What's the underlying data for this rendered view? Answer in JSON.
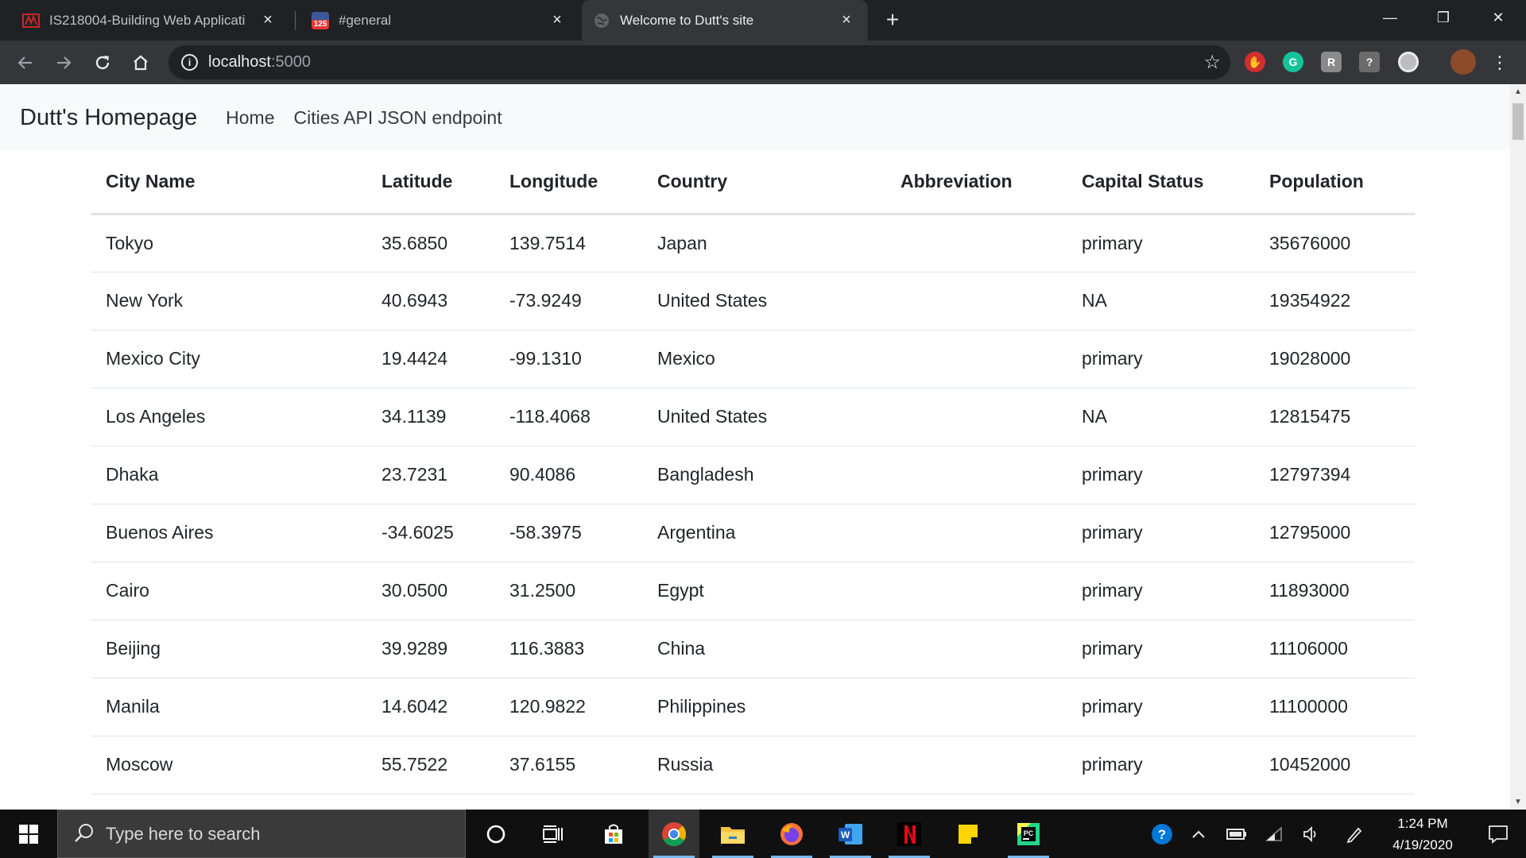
{
  "browser": {
    "tabs": [
      {
        "title": "IS218004-Building Web Applicati",
        "close": "×"
      },
      {
        "title": "#general",
        "close": "×",
        "badge": "125"
      },
      {
        "title": "Welcome to Dutt's site",
        "close": "×"
      }
    ],
    "new_tab": "+",
    "window_controls": {
      "minimize": "—",
      "restore": "❐",
      "close": "✕"
    },
    "address": {
      "host": "localhost",
      "port": ":5000"
    }
  },
  "page": {
    "brand": "Dutt's Homepage",
    "nav": [
      {
        "label": "Home"
      },
      {
        "label": "Cities API JSON endpoint"
      }
    ],
    "table": {
      "columns": [
        "City Name",
        "Latitude",
        "Longitude",
        "Country",
        "Abbreviation",
        "Capital Status",
        "Population"
      ],
      "rows": [
        [
          "Tokyo",
          "35.6850",
          "139.7514",
          "Japan",
          "",
          "primary",
          "35676000"
        ],
        [
          "New York",
          "40.6943",
          "-73.9249",
          "United States",
          "",
          "NA",
          "19354922"
        ],
        [
          "Mexico City",
          "19.4424",
          "-99.1310",
          "Mexico",
          "",
          "primary",
          "19028000"
        ],
        [
          "Los Angeles",
          "34.1139",
          "-118.4068",
          "United States",
          "",
          "NA",
          "12815475"
        ],
        [
          "Dhaka",
          "23.7231",
          "90.4086",
          "Bangladesh",
          "",
          "primary",
          "12797394"
        ],
        [
          "Buenos Aires",
          "-34.6025",
          "-58.3975",
          "Argentina",
          "",
          "primary",
          "12795000"
        ],
        [
          "Cairo",
          "30.0500",
          "31.2500",
          "Egypt",
          "",
          "primary",
          "11893000"
        ],
        [
          "Beijing",
          "39.9289",
          "116.3883",
          "China",
          "",
          "primary",
          "11106000"
        ],
        [
          "Manila",
          "14.6042",
          "120.9822",
          "Philippines",
          "",
          "primary",
          "11100000"
        ],
        [
          "Moscow",
          "55.7522",
          "37.6155",
          "Russia",
          "",
          "primary",
          "10452000"
        ]
      ]
    }
  },
  "taskbar": {
    "search_placeholder": "Type here to search",
    "time": "1:24 PM",
    "date": "4/19/2020"
  },
  "colors": {
    "tabbar_bg": "#202124",
    "toolbar_bg": "#35363a",
    "navbar_bg": "#f8f9fa",
    "taskbar_bg": "#101010",
    "taskbar_accent": "#76b9ed"
  }
}
